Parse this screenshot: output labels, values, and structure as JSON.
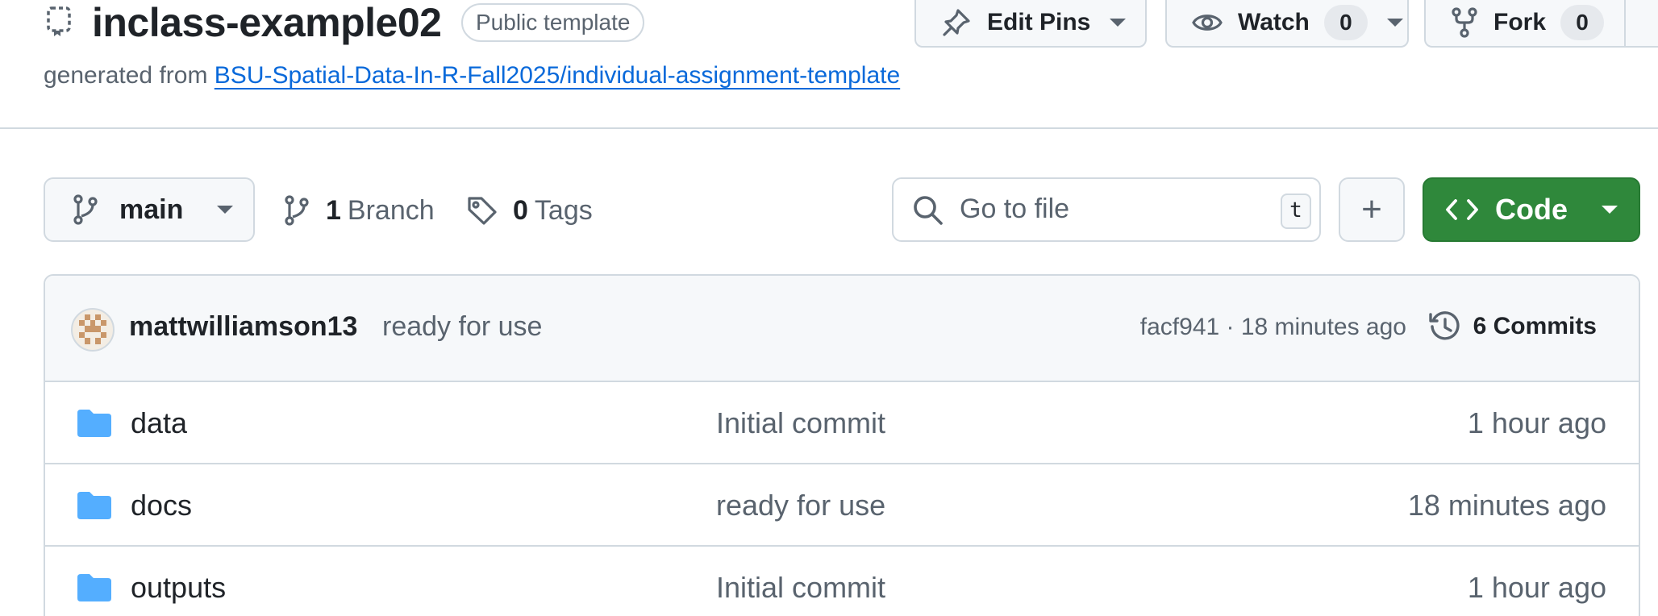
{
  "repo": {
    "name": "inclass-example02",
    "visibility_badge": "Public template",
    "generated_prefix": "generated from",
    "generated_link": "BSU-Spatial-Data-In-R-Fall2025/individual-assignment-template"
  },
  "header_actions": {
    "edit_pins_label": "Edit Pins",
    "watch_label": "Watch",
    "watch_count": "0",
    "fork_label": "Fork",
    "fork_count": "0"
  },
  "toolbar": {
    "branch_name": "main",
    "branch_count": "1",
    "branch_label": "Branch",
    "tag_count": "0",
    "tag_label": "Tags",
    "search_placeholder": "Go to file",
    "search_shortcut": "t",
    "add_label": "+",
    "code_label": "Code"
  },
  "latest_commit": {
    "author": "mattwilliamson13",
    "message": "ready for use",
    "meta": "facf941 · 18 minutes ago",
    "commits_label": "6 Commits"
  },
  "files": [
    {
      "name": "data",
      "message": "Initial commit",
      "time": "1 hour ago"
    },
    {
      "name": "docs",
      "message": "ready for use",
      "time": "18 minutes ago"
    },
    {
      "name": "outputs",
      "message": "Initial commit",
      "time": "1 hour ago"
    }
  ],
  "colors": {
    "accent_blue": "#0969da",
    "code_green": "#2f883b",
    "folder_blue": "#54aeff",
    "muted_text": "#59636e",
    "border": "#d1d9e0"
  }
}
